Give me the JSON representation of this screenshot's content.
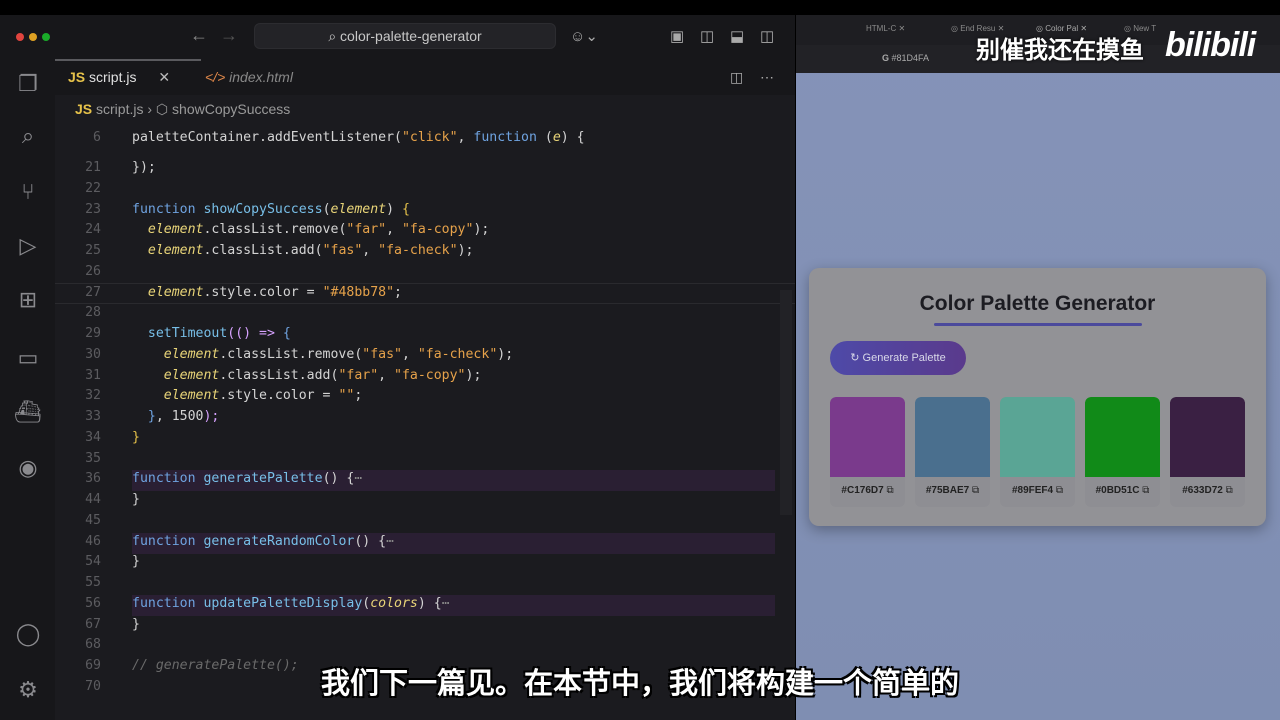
{
  "editor": {
    "search": "color-palette-generator",
    "tabs": [
      {
        "label": "script.js",
        "icon": "JS"
      },
      {
        "label": "index.html",
        "icon": "</>"
      }
    ],
    "breadcrumb": {
      "file": "script.js",
      "symbol": "showCopySuccess"
    },
    "lines": [
      {
        "n": "6",
        "seg": [
          [
            "paletteContainer.addEventListener(",
            "p"
          ],
          [
            "\"click\"",
            "s"
          ],
          [
            ", ",
            "p"
          ],
          [
            "function",
            "k"
          ],
          [
            " (",
            "p"
          ],
          [
            "e",
            "v"
          ],
          [
            ") {",
            "p"
          ]
        ]
      },
      {
        "n": "21",
        "seg": [
          [
            "});",
            "p"
          ]
        ]
      },
      {
        "n": "22",
        "seg": []
      },
      {
        "n": "23",
        "seg": [
          [
            "function ",
            "k"
          ],
          [
            "showCopySuccess",
            "f"
          ],
          [
            "(",
            "p"
          ],
          [
            "element",
            "v"
          ],
          [
            ") ",
            "p"
          ],
          [
            "{",
            "b"
          ]
        ]
      },
      {
        "n": "24",
        "seg": [
          [
            "  element",
            "v"
          ],
          [
            ".classList.remove(",
            "p"
          ],
          [
            "\"far\"",
            "s"
          ],
          [
            ", ",
            "p"
          ],
          [
            "\"fa-copy\"",
            "s"
          ],
          [
            ");",
            "p"
          ]
        ]
      },
      {
        "n": "25",
        "seg": [
          [
            "  element",
            "v"
          ],
          [
            ".classList.add(",
            "p"
          ],
          [
            "\"fas\"",
            "s"
          ],
          [
            ", ",
            "p"
          ],
          [
            "\"fa-check\"",
            "s"
          ],
          [
            ");",
            "p"
          ]
        ]
      },
      {
        "n": "26",
        "seg": []
      },
      {
        "n": "27",
        "seg": [
          [
            "  element",
            "v"
          ],
          [
            ".style.color = ",
            "p"
          ],
          [
            "\"#48bb78\"",
            "s"
          ],
          [
            ";",
            "p"
          ]
        ]
      },
      {
        "n": "28",
        "seg": []
      },
      {
        "n": "29",
        "seg": [
          [
            "  setTimeout",
            "f"
          ],
          [
            "(() => ",
            "n"
          ],
          [
            "{",
            "k"
          ]
        ]
      },
      {
        "n": "30",
        "seg": [
          [
            "    element",
            "v"
          ],
          [
            ".classList.remove(",
            "p"
          ],
          [
            "\"fas\"",
            "s"
          ],
          [
            ", ",
            "p"
          ],
          [
            "\"fa-check\"",
            "s"
          ],
          [
            ");",
            "p"
          ]
        ]
      },
      {
        "n": "31",
        "seg": [
          [
            "    element",
            "v"
          ],
          [
            ".classList.add(",
            "p"
          ],
          [
            "\"far\"",
            "s"
          ],
          [
            ", ",
            "p"
          ],
          [
            "\"fa-copy\"",
            "s"
          ],
          [
            ");",
            "p"
          ]
        ]
      },
      {
        "n": "32",
        "seg": [
          [
            "    element",
            "v"
          ],
          [
            ".style.color = ",
            "p"
          ],
          [
            "\"\"",
            "s"
          ],
          [
            ";",
            "p"
          ]
        ]
      },
      {
        "n": "33",
        "seg": [
          [
            "  }",
            "k"
          ],
          [
            ", 1500",
            "p"
          ],
          [
            ");",
            "n"
          ]
        ]
      },
      {
        "n": "34",
        "seg": [
          [
            "}",
            "b"
          ]
        ]
      },
      {
        "n": "35",
        "seg": []
      },
      {
        "n": "36",
        "seg": [
          [
            "function ",
            "k"
          ],
          [
            "generatePalette",
            "f"
          ],
          [
            "() {",
            "p"
          ],
          [
            "⋯",
            "ell"
          ]
        ],
        "fold": true
      },
      {
        "n": "44",
        "seg": [
          [
            "}",
            "p"
          ]
        ]
      },
      {
        "n": "45",
        "seg": []
      },
      {
        "n": "46",
        "seg": [
          [
            "function ",
            "k"
          ],
          [
            "generateRandomColor",
            "f"
          ],
          [
            "() {",
            "p"
          ],
          [
            "⋯",
            "ell"
          ]
        ],
        "fold": true
      },
      {
        "n": "54",
        "seg": [
          [
            "}",
            "p"
          ]
        ]
      },
      {
        "n": "55",
        "seg": []
      },
      {
        "n": "56",
        "seg": [
          [
            "function ",
            "k"
          ],
          [
            "updatePaletteDisplay",
            "f"
          ],
          [
            "(",
            "p"
          ],
          [
            "colors",
            "v"
          ],
          [
            ") {",
            "p"
          ],
          [
            "⋯",
            "ell"
          ]
        ],
        "fold": true
      },
      {
        "n": "67",
        "seg": [
          [
            "}",
            "p"
          ]
        ]
      },
      {
        "n": "68",
        "seg": []
      },
      {
        "n": "69",
        "seg": [
          [
            "// generatePalette();",
            "c"
          ]
        ]
      },
      {
        "n": "70",
        "seg": []
      }
    ]
  },
  "browser": {
    "tabs": [
      "HTML-C",
      "End Resu",
      "Color Pal",
      "New T"
    ],
    "url": "#81D4FA",
    "watermark": "别催我还在摸鱼",
    "logo": "bilibili",
    "app": {
      "title": "Color Palette Generator",
      "button": "Generate Palette",
      "swatches": [
        {
          "hex": "#C176D7",
          "color": "#7a3a8c"
        },
        {
          "hex": "#75BAE7",
          "color": "#4a6f8e"
        },
        {
          "hex": "#89FEF4",
          "color": "#5aa595"
        },
        {
          "hex": "#0BD51C",
          "color": "#118a18"
        },
        {
          "hex": "#633D72",
          "color": "#3a2043"
        }
      ]
    }
  },
  "subtitle": "我们下一篇见。在本节中，我们将构建一个简单的"
}
